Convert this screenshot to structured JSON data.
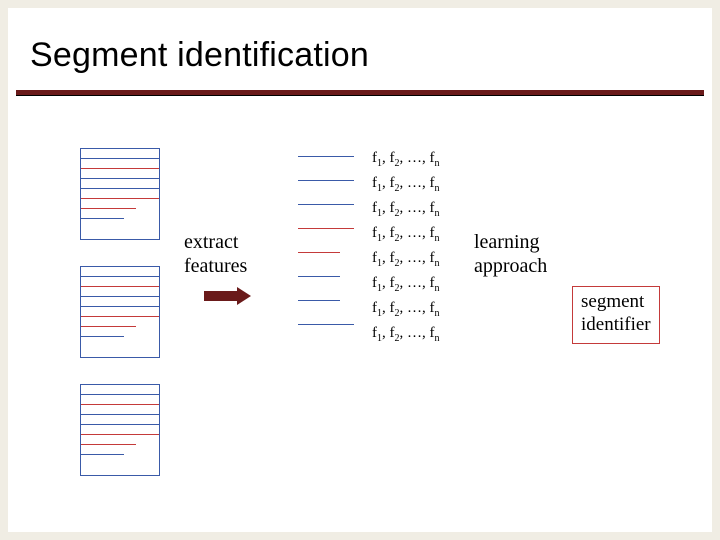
{
  "title": "Segment identification",
  "labels": {
    "extract_line1": "extract",
    "extract_line2": "features",
    "learning_line1": "learning",
    "learning_line2": "approach",
    "segid_line1": "segment",
    "segid_line2": "identifier"
  },
  "feature_template": {
    "f": "f",
    "s1": "1",
    "s2": "2",
    "dots": ", …, ",
    "sn": "n"
  },
  "docs": [
    {
      "lines": [
        "blue",
        "red",
        "blue",
        "blue",
        "red",
        "red shorter1",
        "blue shorter2"
      ]
    },
    {
      "lines": [
        "blue",
        "red",
        "blue",
        "blue",
        "red",
        "red shorter1",
        "blue shorter2"
      ]
    },
    {
      "lines": [
        "blue",
        "red",
        "blue",
        "blue",
        "red",
        "red shorter1",
        "blue shorter2"
      ]
    }
  ],
  "segments": [
    "blue",
    "blue",
    "blue",
    "red",
    "red short",
    "blue short",
    "blue short",
    "blue"
  ],
  "feature_rows": 8
}
